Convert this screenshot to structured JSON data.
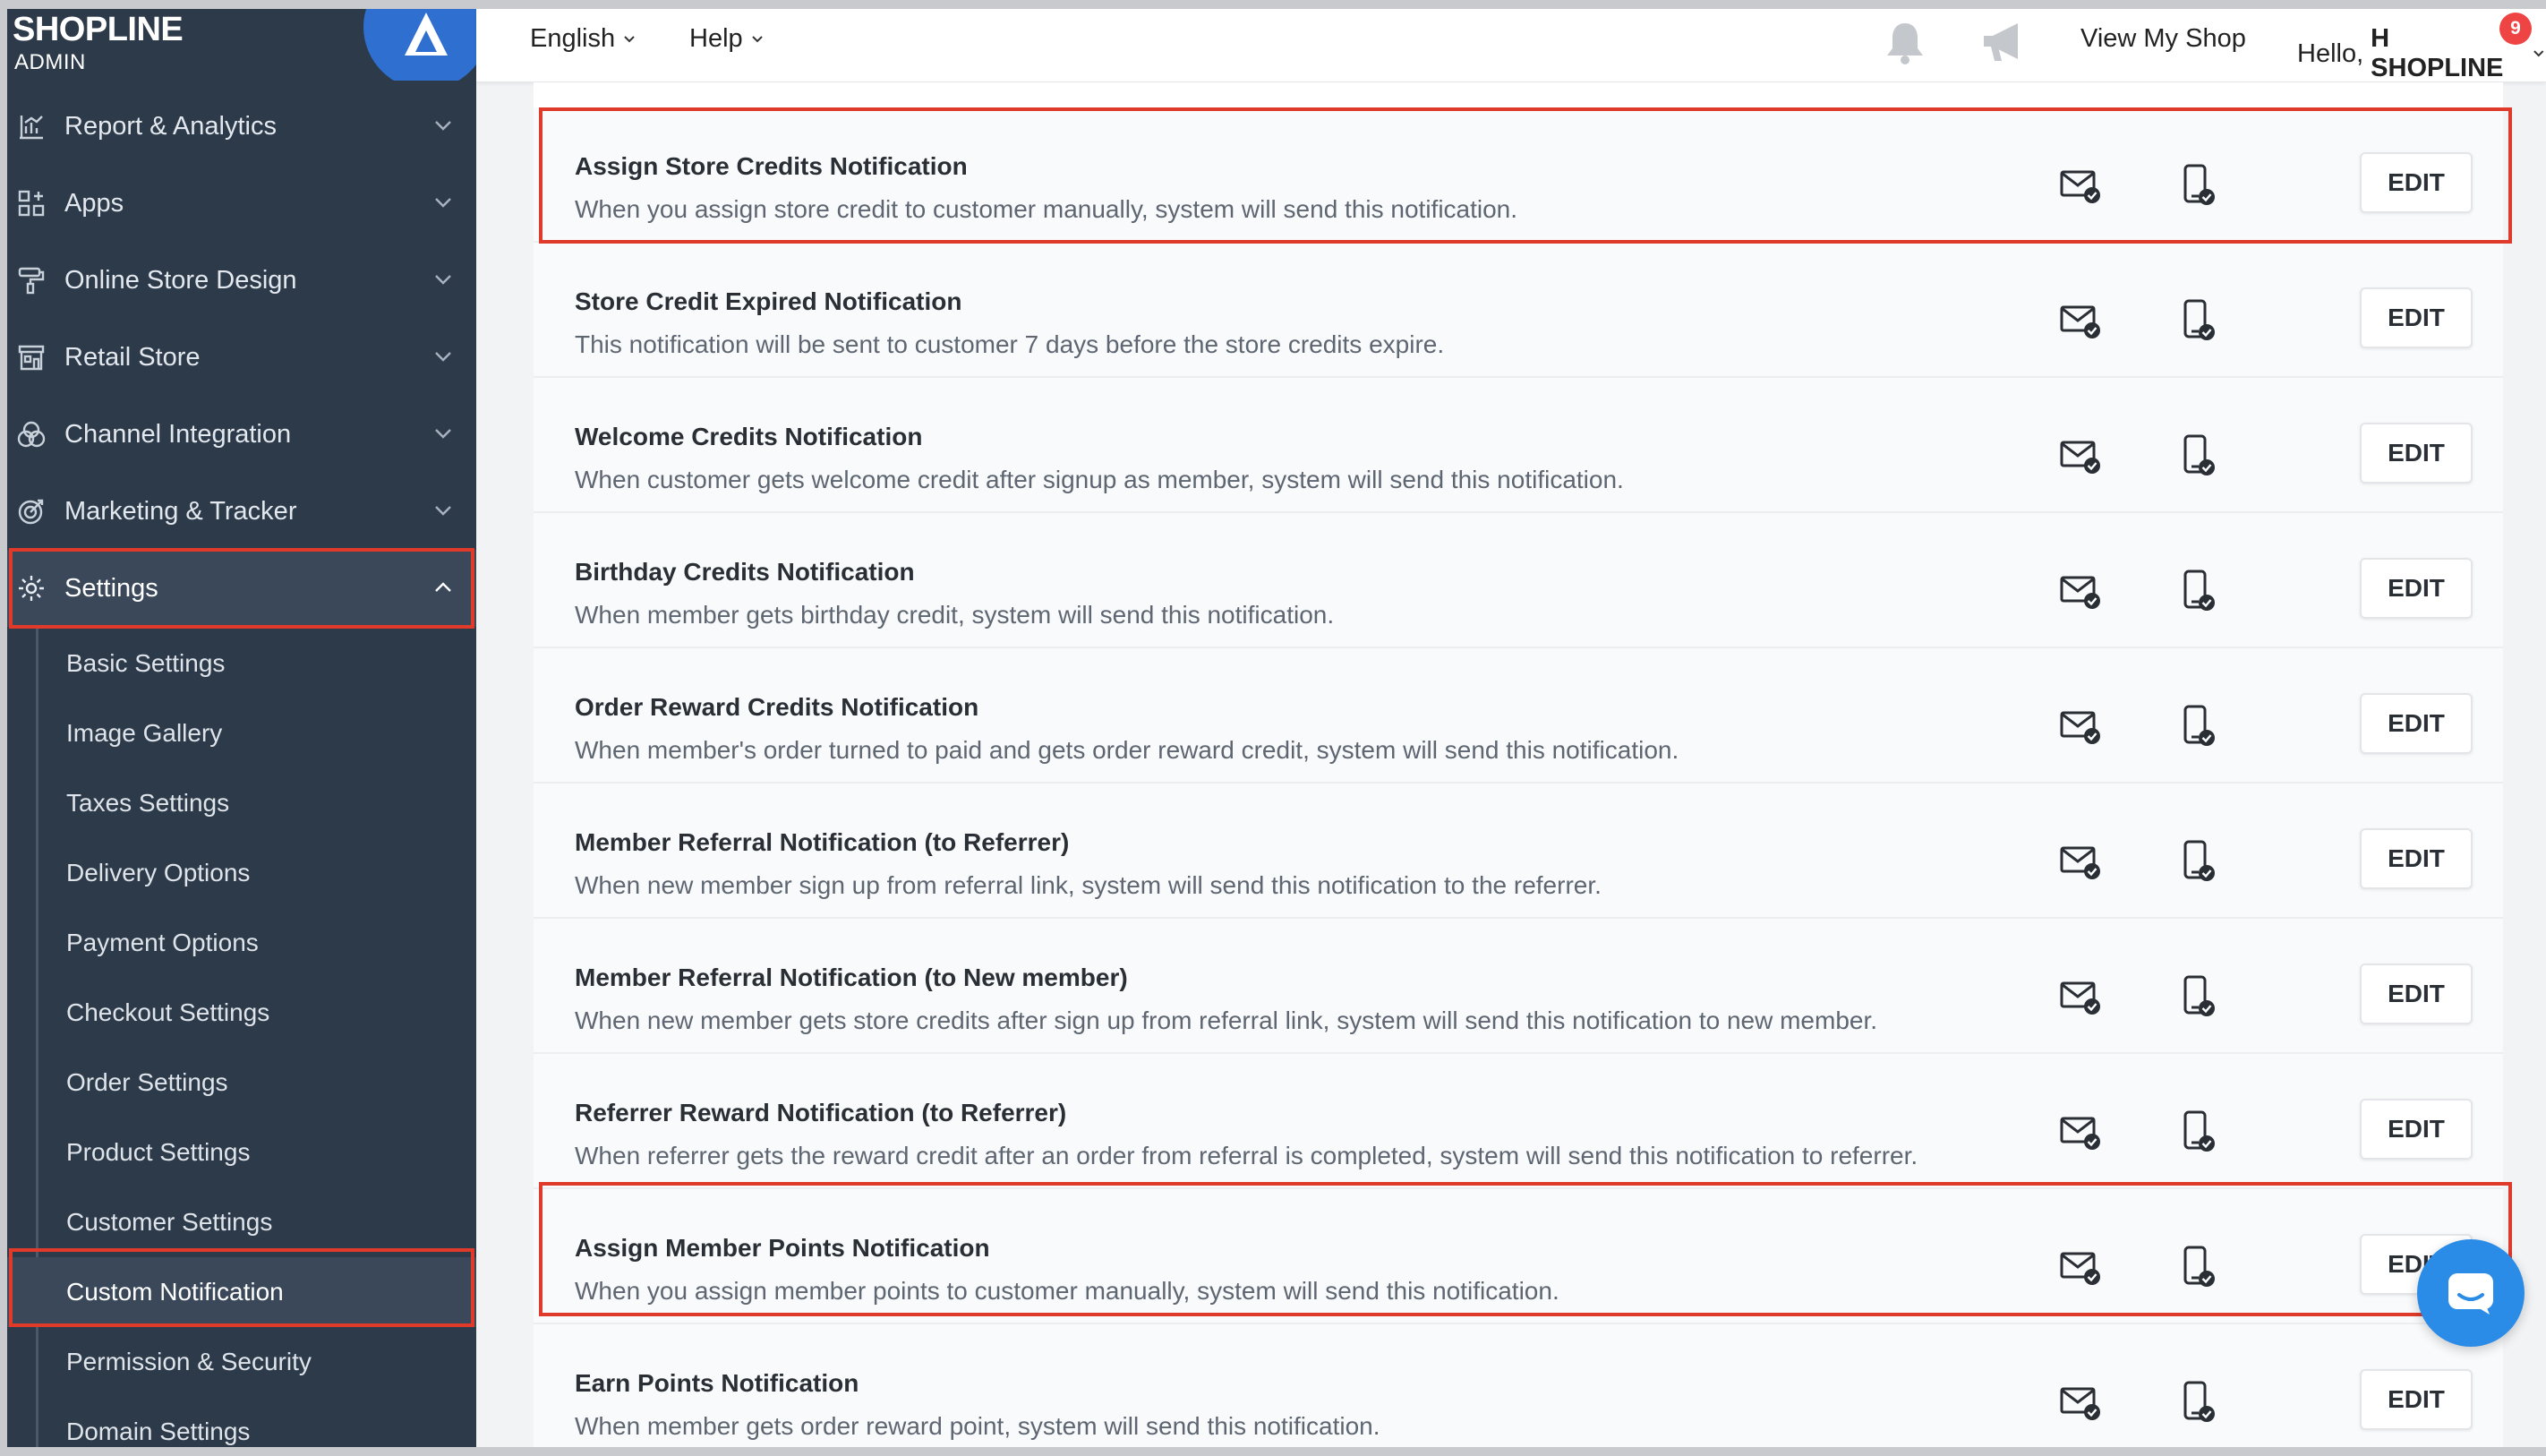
{
  "brand": {
    "name": "SHOPLINE",
    "sub": "ADMIN"
  },
  "sidebar": {
    "items": [
      {
        "label": "Report & Analytics",
        "icon": "chart-icon"
      },
      {
        "label": "Apps",
        "icon": "apps-grid-icon"
      },
      {
        "label": "Online Store Design",
        "icon": "paint-roller-icon"
      },
      {
        "label": "Retail Store",
        "icon": "store-icon"
      },
      {
        "label": "Channel Integration",
        "icon": "channels-icon"
      },
      {
        "label": "Marketing & Tracker",
        "icon": "target-icon"
      },
      {
        "label": "Settings",
        "icon": "gear-icon",
        "expanded": true
      }
    ],
    "subitems": [
      "Basic Settings",
      "Image Gallery",
      "Taxes Settings",
      "Delivery Options",
      "Payment Options",
      "Checkout Settings",
      "Order Settings",
      "Product Settings",
      "Customer Settings",
      "Custom Notification",
      "Permission & Security",
      "Domain Settings"
    ],
    "active_subitem": "Custom Notification"
  },
  "topbar": {
    "language": "English",
    "help": "Help",
    "announcement_count": "9",
    "view_shop": "View My Shop",
    "greeting": "Hello,",
    "user": "H SHOPLINE"
  },
  "notifications": [
    {
      "title": "Assign Store Credits Notification",
      "desc": "When you assign store credit to customer manually, system will send this notification.",
      "highlighted": true
    },
    {
      "title": "Store Credit Expired Notification",
      "desc": "This notification will be sent to customer 7 days before the store credits expire."
    },
    {
      "title": "Welcome Credits Notification",
      "desc": "When customer gets welcome credit after signup as member, system will send this notification."
    },
    {
      "title": "Birthday Credits Notification",
      "desc": "When member gets birthday credit, system will send this notification."
    },
    {
      "title": "Order Reward Credits Notification",
      "desc": "When member's order turned to paid and gets order reward credit, system will send this notification."
    },
    {
      "title": "Member Referral Notification (to Referrer)",
      "desc": "When new member sign up from referral link, system will send this notification to the referrer."
    },
    {
      "title": "Member Referral Notification (to New member)",
      "desc": "When new member gets store credits after sign up from referral link, system will send this notification to new member."
    },
    {
      "title": "Referrer Reward Notification (to Referrer)",
      "desc": "When referrer gets the reward credit after an order from referral is completed, system will send this notification to referrer."
    },
    {
      "title": "Assign Member Points Notification",
      "desc": "When you assign member points to customer manually, system will send this notification.",
      "highlighted": true
    },
    {
      "title": "Earn Points Notification",
      "desc": "When member gets order reward point, system will send this notification."
    }
  ],
  "edit_label": "EDIT",
  "colors": {
    "sidebar_bg": "#2d3a4a",
    "highlight": "#e03a2b",
    "chat": "#2b8ce8",
    "badge": "#ef4444"
  }
}
